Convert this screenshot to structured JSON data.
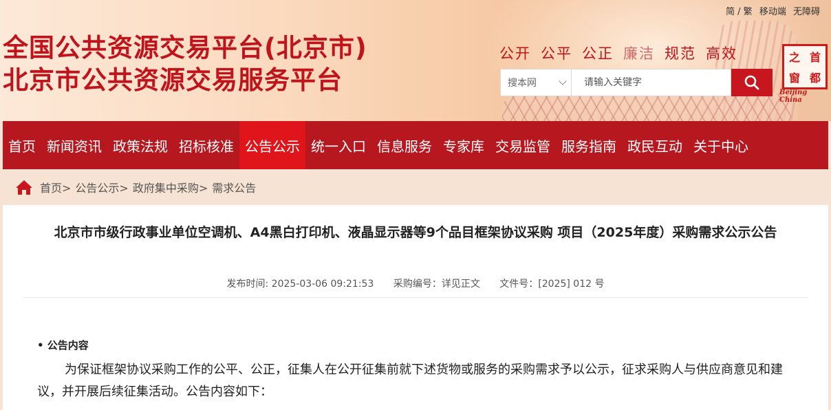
{
  "header": {
    "title_line1": "全国公共资源交易平台(北京市)",
    "title_line2": "北京市公共资源交易服务平台",
    "top_links": [
      "简 / 繁",
      "移动端",
      "无障碍"
    ],
    "slogans": [
      "公开",
      "公平",
      "公正",
      "廉洁",
      "规范",
      "高效"
    ],
    "search": {
      "scope": "搜本网",
      "placeholder": "请输入关键字"
    },
    "logo": {
      "chars": [
        "之",
        "首",
        "窗",
        "都"
      ],
      "subtitle": "Beijing China"
    }
  },
  "nav": {
    "items": [
      "首页",
      "新闻资讯",
      "政策法规",
      "招标核准",
      "公告公示",
      "统一入口",
      "信息服务",
      "专家库",
      "交易监管",
      "服务指南",
      "政民互动",
      "关于中心"
    ],
    "active_index": 4
  },
  "breadcrumb": {
    "items": [
      "首页>",
      "公告公示>",
      "政府集中采购>",
      "需求公告"
    ]
  },
  "article": {
    "title": "北京市市级行政事业单位空调机、A4黑白打印机、液晶显示器等9个品目框架协议采购 项目（2025年度）采购需求公示公告",
    "meta": {
      "published": "发布时间:   2025-03-06 09:21:53",
      "purchase_no": "采购编号：详见正文",
      "doc_no": "文件号：[2025] 012 号"
    },
    "section_heading": "• 公告内容",
    "paragraph": "为保证框架协议采购工作的公平、公正，征集人在公开征集前就下述货物或服务的采购需求予以公示，征求采购人与供应商意见和建议，并开展后续征集活动。公告内容如下："
  },
  "colors": {
    "brand_red": "#c0141c",
    "nav_bg": "#b7171f",
    "nav_active": "#e0141b",
    "search_button": "#c8161e"
  },
  "icons": {
    "home": "home-icon",
    "search": "search-icon",
    "dropdown": "chevron-down-icon"
  }
}
